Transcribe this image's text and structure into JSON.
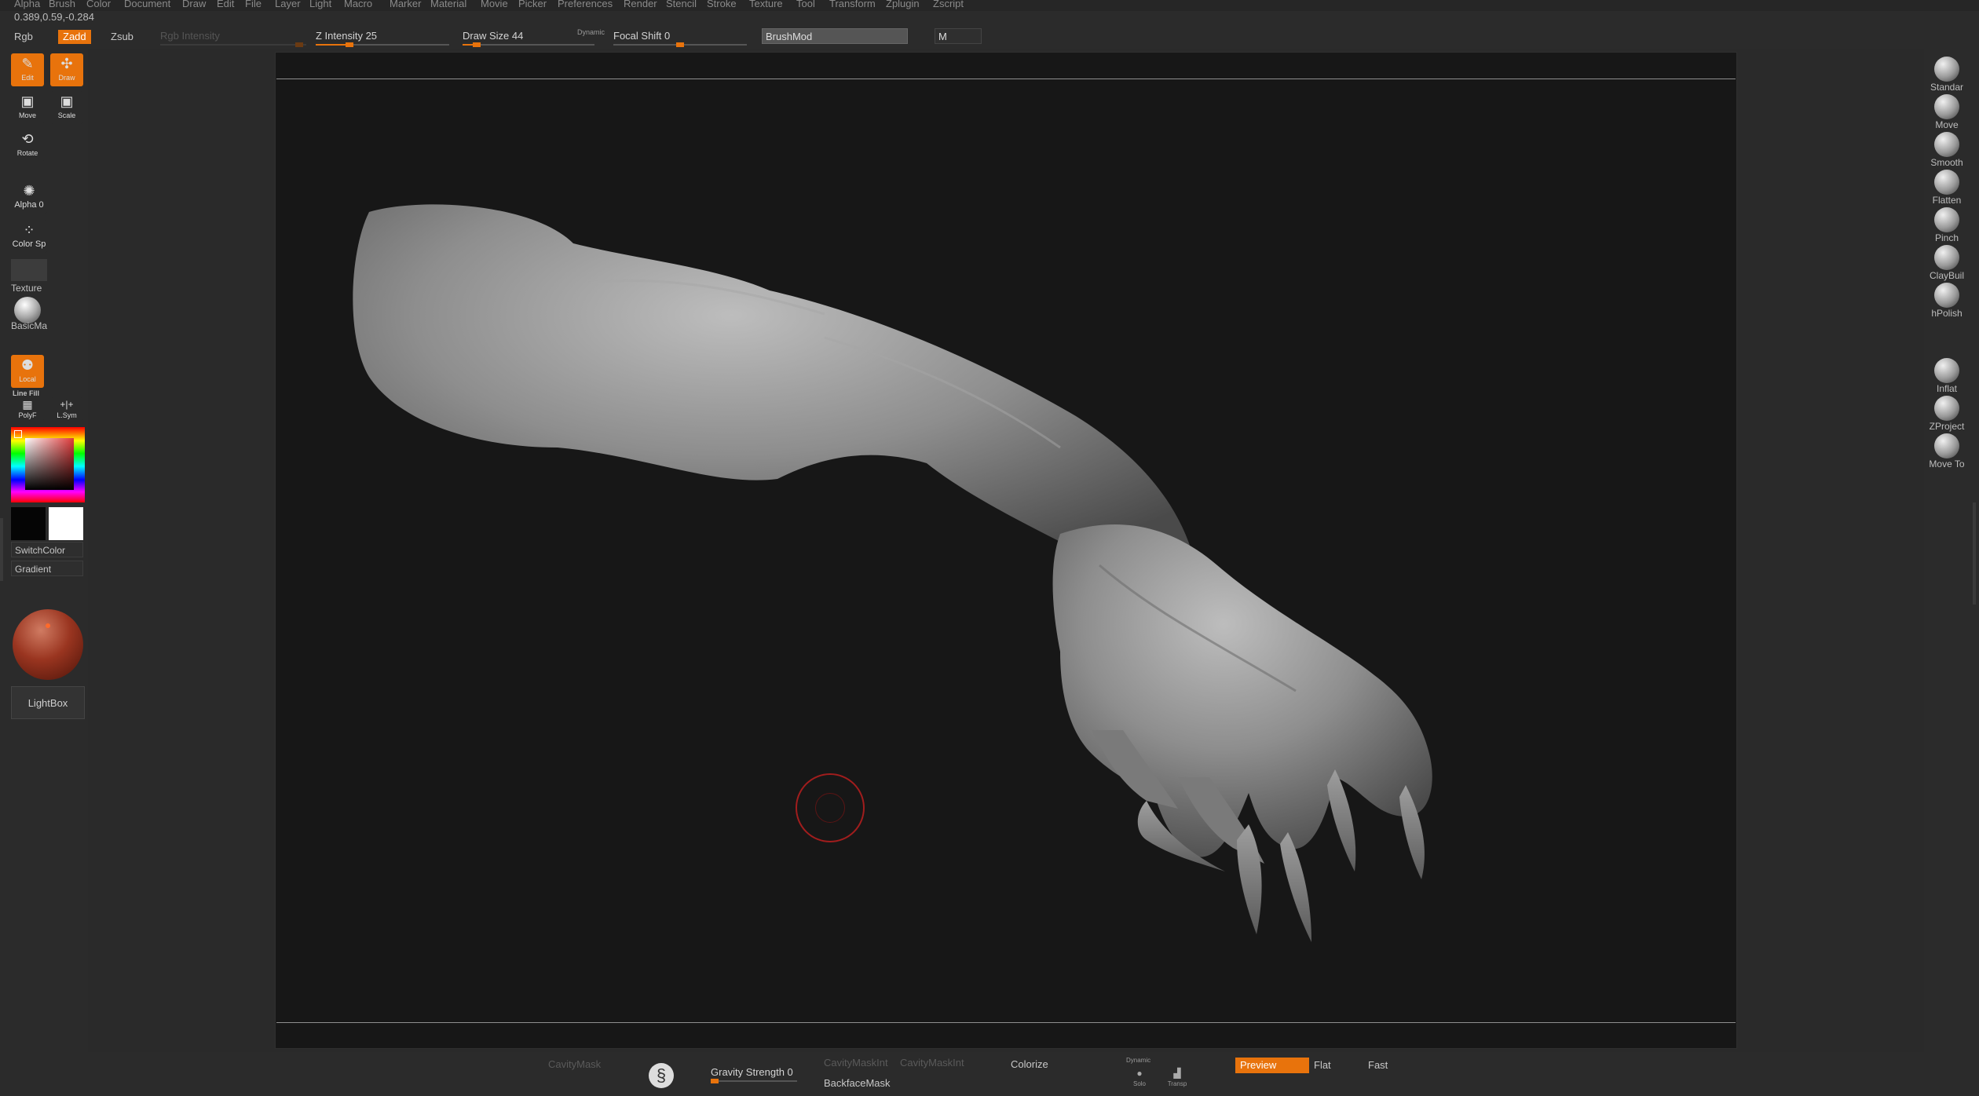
{
  "menu": [
    "Alpha",
    "Brush",
    "Color",
    "Document",
    "Draw",
    "Edit",
    "File",
    "Layer",
    "Light",
    "Macro",
    "Marker",
    "Material",
    "Movie",
    "Picker",
    "Preferences",
    "Render",
    "Stencil",
    "Stroke",
    "Texture",
    "Tool",
    "Transform",
    "Zplugin",
    "Zscript"
  ],
  "status": {
    "coords": "0.389,0.59,-0.284"
  },
  "topbar": {
    "rgb": "Rgb",
    "zadd": "Zadd",
    "zsub": "Zsub",
    "rgb_intensity": "Rgb Intensity",
    "z_intensity": "Z Intensity 25",
    "z_intensity_value": 25,
    "draw_size": "Draw Size 44",
    "draw_size_value": 44,
    "dynamic": "Dynamic",
    "focal_shift": "Focal Shift 0",
    "focal_shift_value": 0,
    "brushmod": "BrushMod",
    "m": "M"
  },
  "leftbar": {
    "edit": "Edit",
    "draw": "Draw",
    "move": "Move",
    "scale": "Scale",
    "rotate": "Rotate",
    "alpha": "Alpha 0",
    "color_spray": "Color Sp",
    "texture": "Texture",
    "material": "BasicMa",
    "local": "Local",
    "line_fill": "Line Fill",
    "polyf": "PolyF",
    "lsym": "L.Sym",
    "switch_color": "SwitchColor",
    "gradient": "Gradient",
    "lightbox": "LightBox"
  },
  "brushes": [
    "Standar",
    "Move",
    "Smooth",
    "Flatten",
    "Pinch",
    "ClayBuil",
    "hPolish",
    "Inflat",
    "ZProject",
    "Move To"
  ],
  "bottombar": {
    "cavity_mask": "CavityMask",
    "gravity_strength": "Gravity Strength 0",
    "cavity_mask_int_1": "CavityMaskInt",
    "cavity_mask_int_2": "CavityMaskInt",
    "backface_mask": "BackfaceMask",
    "colorize": "Colorize",
    "dynamic": "Dynamic",
    "solo": "Solo",
    "transp": "Transp",
    "preview": "Preview",
    "flat": "Flat",
    "fast": "Fast"
  },
  "colors": {
    "accent": "#e8730c",
    "canvas": "#171717",
    "ui": "#2b2b2b"
  },
  "icons": [
    "edit-icon",
    "draw-icon",
    "move-icon",
    "scale-icon",
    "rotate-icon",
    "alpha-icon",
    "spray-icon",
    "sphere-brush-icon",
    "brush-cursor-icon",
    "sculptris-logo-icon"
  ]
}
